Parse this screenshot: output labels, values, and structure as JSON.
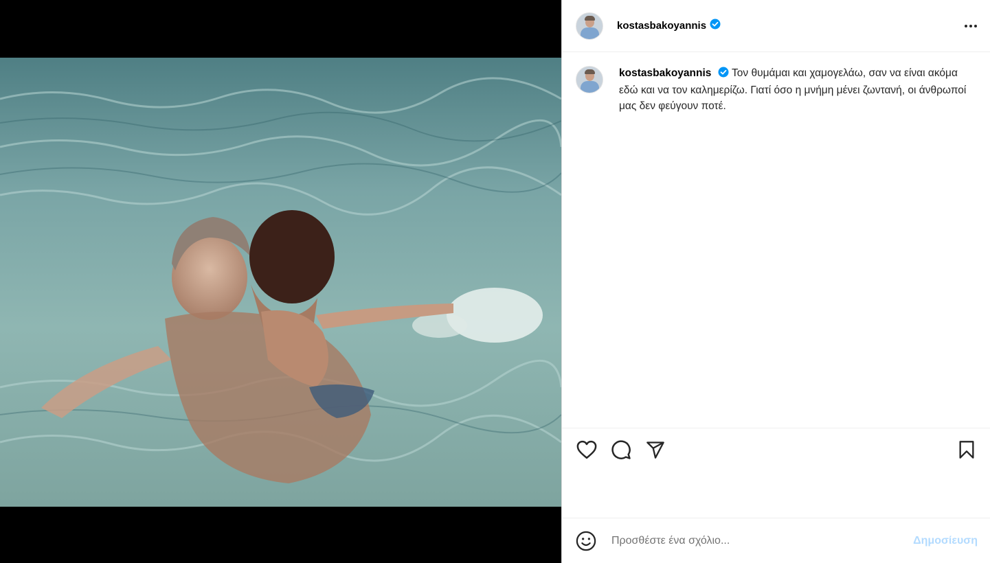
{
  "post": {
    "username": "kostasbakoyannis",
    "verified": true,
    "caption": "Τον θυμάμαι και χαμογελάω, σαν να είναι ακόμα εδώ και να τον καλημερίζω. Γιατί όσο η μνήμη μένει ζωντανή, οι άνθρωποί μας δεν φεύγουν ποτέ.",
    "image_description_icon": "photo-pool"
  },
  "icons": {
    "more": "more-horizontal-icon",
    "like": "heart-icon",
    "comment": "comment-icon",
    "share": "share-icon",
    "save": "bookmark-icon",
    "emoji": "emoji-icon",
    "verified": "verified-badge-icon"
  },
  "comment": {
    "placeholder": "Προσθέστε ένα σχόλιο...",
    "post_label": "Δημοσίευση"
  },
  "colors": {
    "verified": "#0095f6",
    "post_button_disabled": "#b3dbff",
    "border": "#efefef"
  }
}
